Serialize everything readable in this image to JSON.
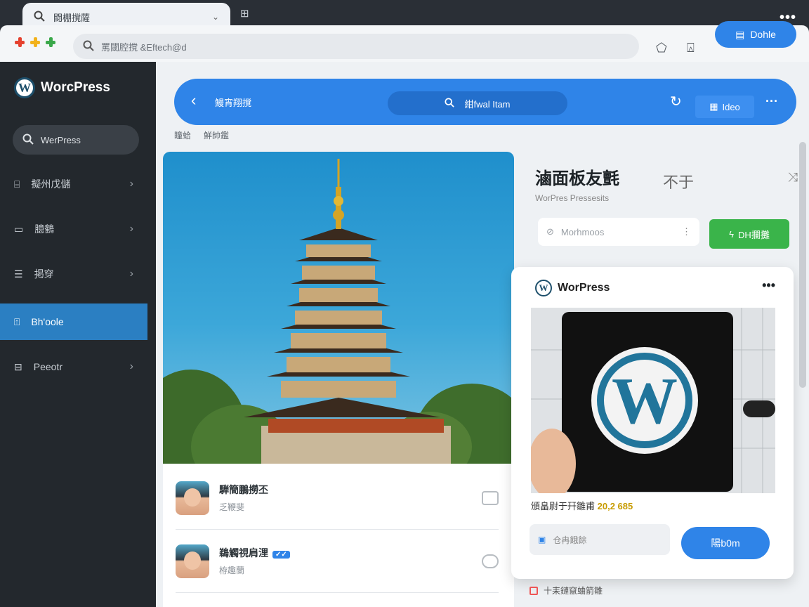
{
  "browser": {
    "tab_title": "闘棚撹薩",
    "tab2_icon": "new-tab-icon",
    "address_text": "罵閾腔撹 &Eftech@d",
    "login_label": "Dohle"
  },
  "colors": {
    "accent": "#2f84e8",
    "sidebar_bg": "#23282d",
    "success": "#3ab44a"
  },
  "sidebar": {
    "logo": "WorcPress",
    "search": "WerPress",
    "items": [
      {
        "icon": "dashboard-icon",
        "label": "擬州戊儲",
        "chevron": true,
        "active": false
      },
      {
        "icon": "monitor-icon",
        "label": "臆鶴",
        "chevron": true,
        "active": false
      },
      {
        "icon": "list-icon",
        "label": "掲穿",
        "chevron": true,
        "active": false
      },
      {
        "icon": "page-icon",
        "label": "Bh'oole",
        "chevron": false,
        "active": true
      },
      {
        "icon": "plugin-icon",
        "label": "Peeotr",
        "chevron": true,
        "active": false
      }
    ]
  },
  "topbar": {
    "title": "鰻宵翔撹",
    "search": "紺fwal Itam",
    "button": "Ideo"
  },
  "breadcrumb": [
    "瞳蛤",
    "鮮帥鑑"
  ],
  "posts": [
    {
      "name": "騨簡鵬撈丕",
      "sub": "乏鞭斐",
      "tag": ""
    },
    {
      "name": "鵜觸視肩浬",
      "sub": "栫趣蘭",
      "tag": "✓✓"
    }
  ],
  "panel": {
    "title": "滷面板友氈",
    "side": "不于",
    "sub": "WorPres Pressesits",
    "input_text": "Morhmoos",
    "green_button": "DH攔攤"
  },
  "card": {
    "brand": "WorPress",
    "price_label": "頒畠尉于幵雛甫",
    "price_value": "20,2 685",
    "input_text": "仓冉餓餘",
    "button": "陽b0m"
  },
  "footnote": "十耒鏈竄蛐箭雛"
}
